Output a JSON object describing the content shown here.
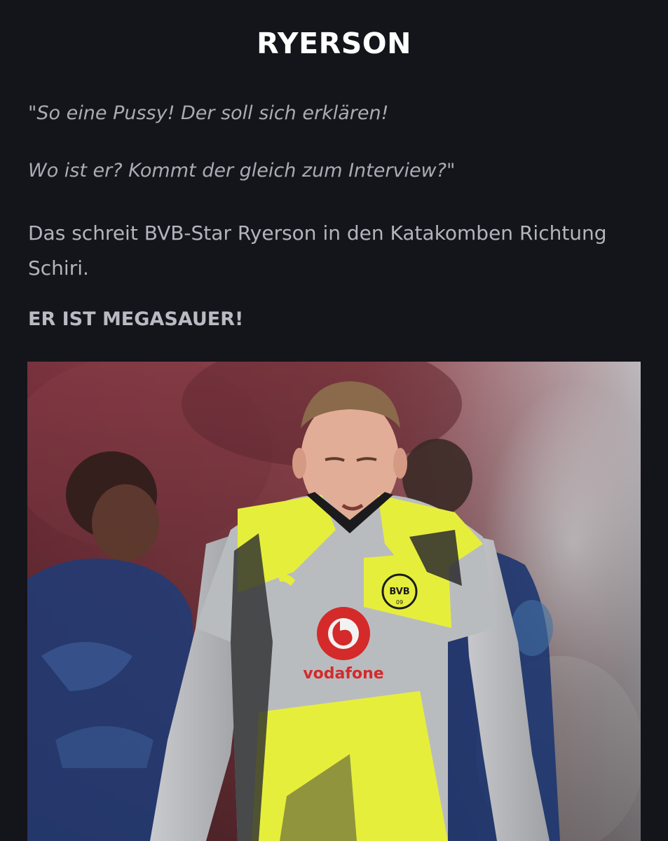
{
  "article": {
    "headline": "RYERSON",
    "quote_line_1": "\"So eine Pussy! Der soll sich erklären!",
    "quote_line_2": "Wo ist er? Kommt der gleich zum Interview?\"",
    "paragraph": "Das schreit BVB-Star Ryerson in den Katakomben Richtung Schiri.",
    "emphasis": "ER IST MEGASAUER!"
  },
  "photo": {
    "jersey_sponsor": "vodafone",
    "crest_text": "BVB",
    "crest_year": "09",
    "colors": {
      "background": "#14151a",
      "jersey_yellow": "#e6ee3c",
      "jersey_grey": "#b9bcbf",
      "sponsor_red": "#d42a2a",
      "stadium_red": "#8e3a44",
      "opponent_blue": "#1f3c78"
    }
  }
}
